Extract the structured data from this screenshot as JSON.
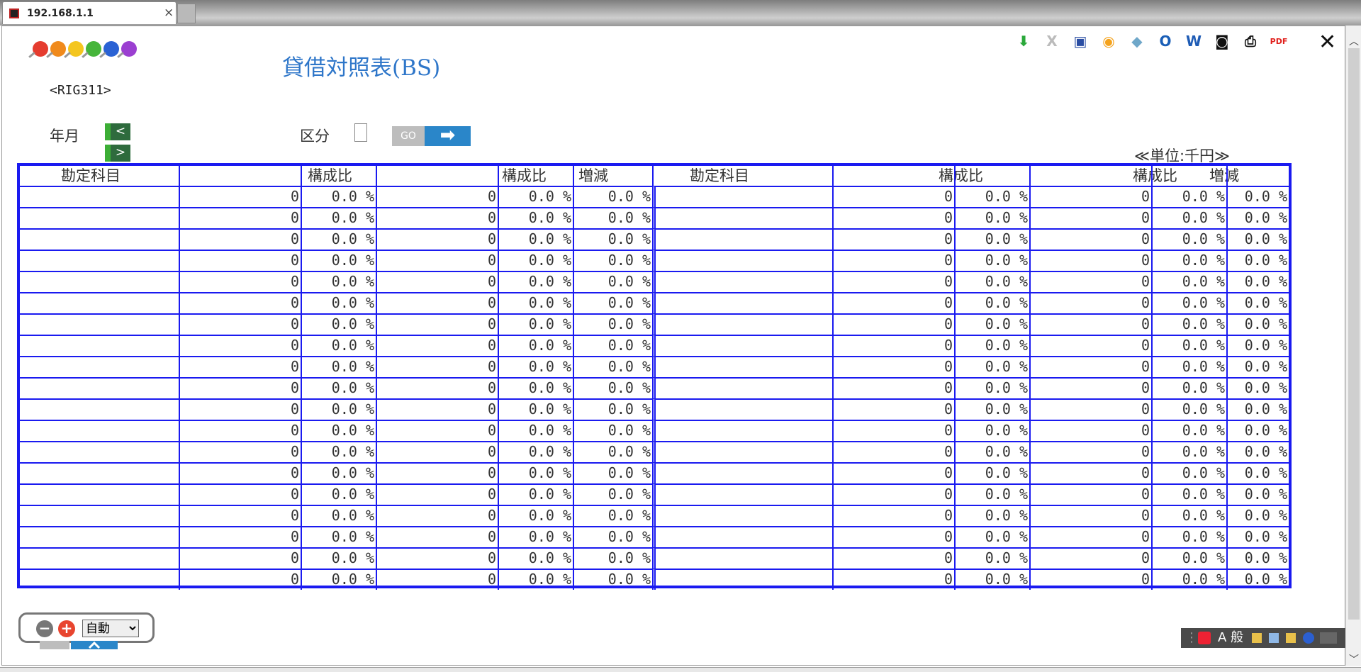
{
  "browser": {
    "tab_title": "192.168.1.1",
    "close_glyph": "×"
  },
  "header": {
    "title": "貸借対照表(BS)",
    "page_id": "<RIG311>",
    "close_glyph": "✕"
  },
  "toolbar": [
    {
      "name": "download-icon",
      "label": "⬇",
      "color": "#2aa83a"
    },
    {
      "name": "excel-gray-icon",
      "label": "X",
      "color": "#bbbbbb"
    },
    {
      "name": "image-icon",
      "label": "▣",
      "color": "#2a4da3"
    },
    {
      "name": "palette-icon",
      "label": "◉",
      "color": "#f4a21c"
    },
    {
      "name": "eraser-icon",
      "label": "◆",
      "color": "#6fa7c9"
    },
    {
      "name": "outlook-icon",
      "label": "O",
      "color": "#1b5fb7"
    },
    {
      "name": "word-icon",
      "label": "W",
      "color": "#1f5cb5"
    },
    {
      "name": "camera-icon",
      "label": "◙",
      "color": "#111111"
    },
    {
      "name": "print-icon",
      "label": "⎙",
      "color": "#111111"
    },
    {
      "name": "pdf-icon",
      "label": "PDF",
      "color": "#e0201c"
    }
  ],
  "form": {
    "yearmonth_label": "年月",
    "prev_label": "<",
    "next_label": ">",
    "kubun_label": "区分",
    "go_label": "GO",
    "go_arrow": "➡",
    "unit_label": "≪単位:千円≫"
  },
  "table": {
    "headers_left": {
      "account": "勘定科目",
      "ratio1": "構成比",
      "ratio2": "構成比",
      "change": "増減"
    },
    "headers_right": {
      "account": "勘定科目",
      "ratio1": "構成比",
      "ratio2": "構成比",
      "change": "増減"
    },
    "row_count": 19,
    "amount": "0",
    "ratio": "0.0 %"
  },
  "zoom": {
    "minus": "−",
    "plus": "+",
    "mode": "自動",
    "options": [
      "自動"
    ]
  },
  "ime": {
    "text": "A 般"
  },
  "colors": {
    "grid": "#1a1af0",
    "title": "#2e76c9",
    "nav": "#2e6b3d"
  }
}
